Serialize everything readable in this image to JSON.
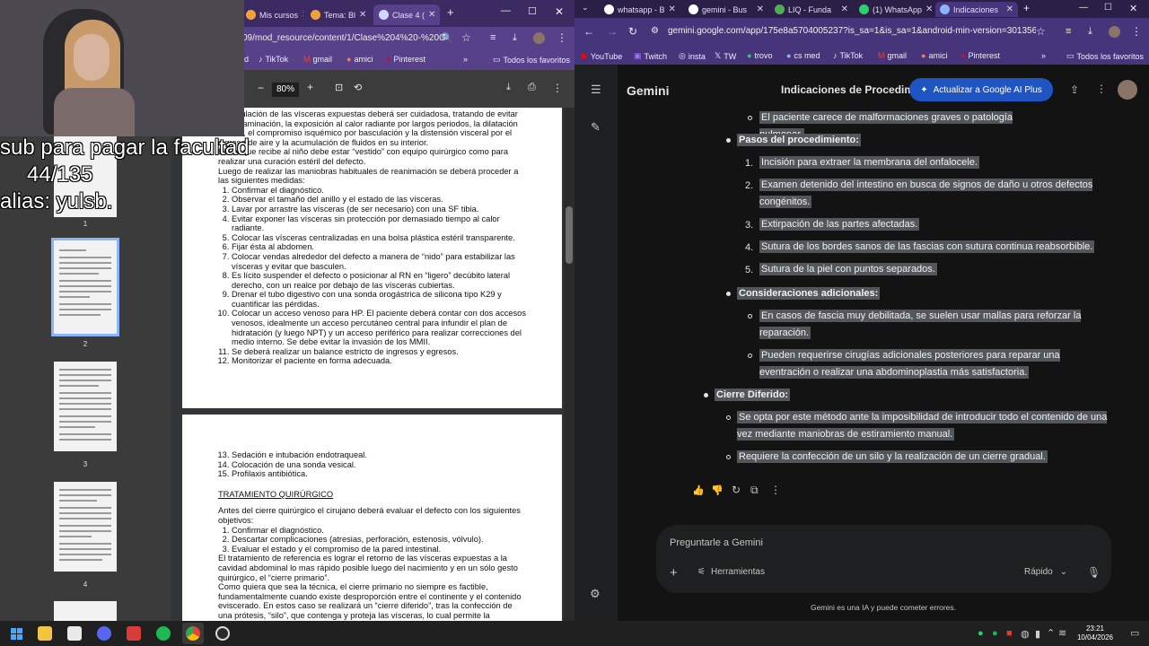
{
  "overlay": {
    "line1": "sub para pagar la facultad",
    "line2": "44/135",
    "line3": "alias: yulsb."
  },
  "left_browser": {
    "tabs": [
      {
        "label": "Mis cursos"
      },
      {
        "label": "Tema: Bl"
      },
      {
        "label": "Clase 4 ("
      }
    ],
    "url": "09/mod_resource/content/1/Clase%204%20-%20G",
    "bookmarks": [
      "d",
      "TikTok",
      "gmail",
      "amici",
      "Pinterest",
      "Todos los favoritos"
    ],
    "zoom": "80%",
    "thumb_numbers": [
      "1",
      "2",
      "3",
      "4"
    ]
  },
  "pdf": {
    "page1_intro": [
      "Manipulación de las vísceras expuestas deberá ser cuidadosa, tratando de evitar la contaminación, la exposición al calor radiante por largos periodos, la dilatación de asa, el compromiso isquémico por basculación y la distensión visceral por el ingreso de aire y la acumulación de fluidos en su interior.",
      "El RN que recibe al niño debe estar “vestido” con equipo quirúrgico como para realizar una curación estéril del defecto.",
      "Luego de realizar las maniobras habituales de reanimación se deberá proceder a las siguientes medidas:"
    ],
    "page1_list": [
      "Confirmar el diagnóstico.",
      "Observar el tamaño del anillo y el estado de las vísceras.",
      "Lavar por arrastre las vísceras (de ser necesario) con una SF tibia.",
      "Evitar exponer las vísceras sin protección por demasiado tiempo al calor radiante.",
      "Colocar las vísceras centralizadas en una bolsa plástica estéril transparente.",
      "Fijar ésta al abdomen.",
      "Colocar vendas alrededor del defecto a manera de “nido” para estabilizar las vísceras y evitar que basculen.",
      "Es lícito suspender el defecto o posicionar al RN en “ligero” decúbito lateral derecho, con un realce por debajo de las vísceras cubiertas.",
      "Drenar el tubo digestivo con una sonda orogástrica de silicona tipo K29 y cuantificar las pérdidas.",
      "Colocar un acceso venoso para HP. El paciente deberá contar con dos accesos venosos, idealmente un acceso percutáneo central para infundir el plan de hidratación (y luego NPT) y un acceso periférico para realizar correcciones del medio interno. Se debe evitar la invasión de los MMII.",
      "Se deberá realizar un balance estricto de ingresos y egresos.",
      "Monitorizar el paciente en forma adecuada."
    ],
    "page2_list": [
      "Sedación e intubación endotraqueal.",
      "Colocación de una sonda vesical.",
      "Profilaxis antibiótica."
    ],
    "page2_heading": "TRATAMIENTO QUIRÚRGICO",
    "page2_p1": "Antes del cierre quirúrgico el cirujano deberá evaluar el defecto con los siguientes objetivos:",
    "page2_list2": [
      "Confirmar el diagnóstico.",
      "Descartar complicaciones (atresias, perforación, estenosis, vólvulo).",
      "Evaluar el estado y el compromiso de la pared intestinal."
    ],
    "page2_p2": "El tratamiento de referencia es lograr el retorno de las vísceras expuestas a la cavidad abdominal lo mas rápido posible luego del nacimiento y en un sólo gesto quirúrgico, el “cierre primario”.",
    "page2_p3": "Como quiera que sea la técnica, el cierre primario no siempre es factible, fundamentalmente cuando existe desproporción entre el continente y el contenido eviscerado. En estos caso se realizará un “cierre diferido”, tras la confección de una prótesis, “silo”, que contenga y proteja las vísceras, lo cual permite la"
  },
  "right_browser": {
    "tabs": [
      {
        "label": "whatsapp - B"
      },
      {
        "label": "gemini - Bus"
      },
      {
        "label": "LIQ - Funda"
      },
      {
        "label": "(1) WhatsApp"
      },
      {
        "label": "Indicaciones"
      }
    ],
    "url": "gemini.google.com/app/175e8a5704005237?is_sa=1&is_sa=1&android-min-version=301356232...",
    "bookmarks": [
      "YouTube",
      "Twitch",
      "insta",
      "TW",
      "trovo",
      "cs med",
      "TikTok",
      "gmail",
      "amici",
      "Pinterest",
      "Todos los favoritos"
    ]
  },
  "gemini": {
    "brand": "Gemini",
    "chat_title": "Indicaciones de Procedimie",
    "upgrade": "Actualizar a Google AI Plus",
    "line_top": "El paciente carece de malformaciones graves o patología pulmonar.",
    "pasos_title": "Pasos del procedimiento:",
    "pasos": [
      "Incisión para extraer la membrana del onfalocele.",
      "Examen detenido del intestino en busca de signos de daño u otros defectos congénitos.",
      "Extirpación de las partes afectadas.",
      "Sutura de los bordes sanos de las fascias con sutura continua reabsorbible.",
      "Sutura de la piel con puntos separados."
    ],
    "cons_title": "Consideraciones adicionales:",
    "cons": [
      "En casos de fascia muy debilitada, se suelen usar mallas para reforzar la reparación.",
      "Pueden requerirse cirugías adicionales posteriores para reparar una eventración o realizar una abdominoplastia más satisfactoria."
    ],
    "cierre_title": "Cierre Diferido:",
    "cierre": [
      "Se opta por este método ante la imposibilidad de introducir todo el contenido de una vez mediante maniobras de estiramiento manual.",
      "Requiere la confección de un silo y la realización de un cierre gradual."
    ],
    "input_placeholder": "Preguntarle a Gemini",
    "tools": "Herramientas",
    "mode": "Rápido",
    "footer": "Gemini es una IA y puede cometer errores."
  },
  "taskbar": {
    "time": "23:21",
    "date": "10/04/2026"
  }
}
